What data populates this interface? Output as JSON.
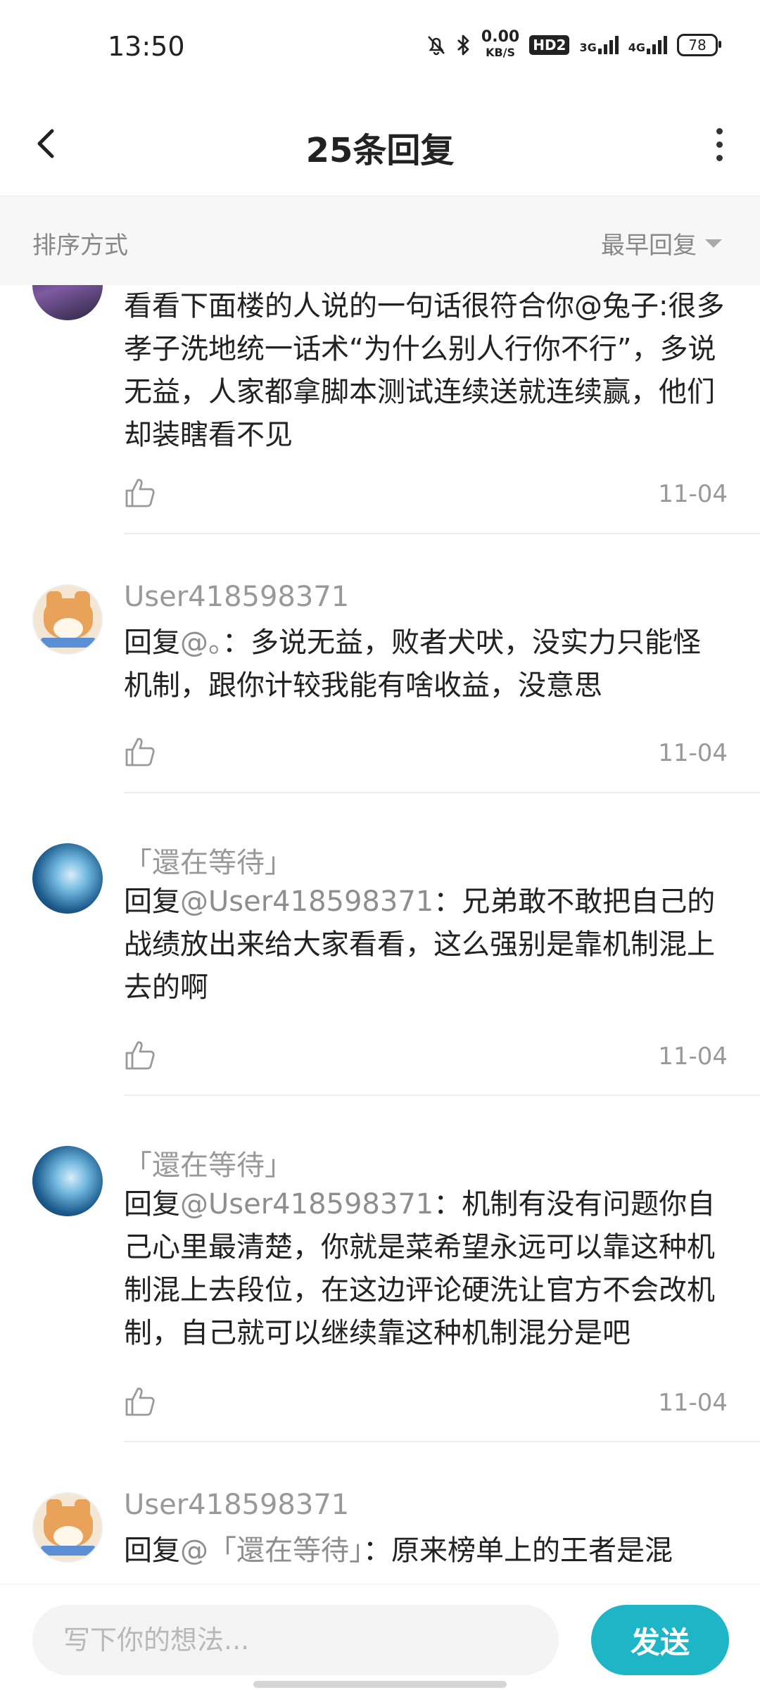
{
  "status_bar": {
    "time": "13:50",
    "net_speed_value": "0.00",
    "net_speed_unit": "KB/S",
    "hd_badge": "HD2",
    "signal_1_label": "3G",
    "signal_2_label": "4G",
    "battery": "78"
  },
  "header": {
    "title": "25条回复"
  },
  "sort": {
    "label": "排序方式",
    "value": "最早回复"
  },
  "replies": [
    {
      "author": "",
      "prefix": "",
      "mention": "",
      "separator": "",
      "text": "看看下面楼的人说的一句话很符合你@兔子:很多孝子洗地统一话术“为什么别人行你不行”，多说无益，人家都拿脚本测试连续送就连续赢，他们却装瞎看不见",
      "date": "11-04"
    },
    {
      "author": "User418598371",
      "prefix": "回复",
      "mention": "@。",
      "separator": "：",
      "text": "多说无益，败者犬吠，没实力只能怪机制，跟你计较我能有啥收益，没意思",
      "date": "11-04"
    },
    {
      "author": "「還在等待」",
      "prefix": "回复",
      "mention": "@User418598371",
      "separator": "：",
      "text": "兄弟敢不敢把自己的战绩放出来给大家看看，这么强别是靠机制混上去的啊",
      "date": "11-04"
    },
    {
      "author": "「還在等待」",
      "prefix": "回复",
      "mention": "@User418598371",
      "separator": "：",
      "text": "机制有没有问题你自己心里最清楚，你就是菜希望永远可以靠这种机制混上去段位，在这边评论硬洗让官方不会改机制，自己就可以继续靠这种机制混分是吧",
      "date": "11-04"
    },
    {
      "author": "User418598371",
      "prefix": "回复",
      "mention": "@「還在等待」",
      "separator": "：",
      "text": "原来榜单上的王者是混",
      "date": ""
    }
  ],
  "composer": {
    "placeholder": "写下你的想法...",
    "send_label": "发送"
  },
  "colors": {
    "accent": "#1eb6c7",
    "mention": "#8e8e8e",
    "meta": "#999999"
  },
  "icons": [
    "back-arrow-icon",
    "more-vertical-icon",
    "sort-caret-icon",
    "thumbs-up-icon"
  ]
}
